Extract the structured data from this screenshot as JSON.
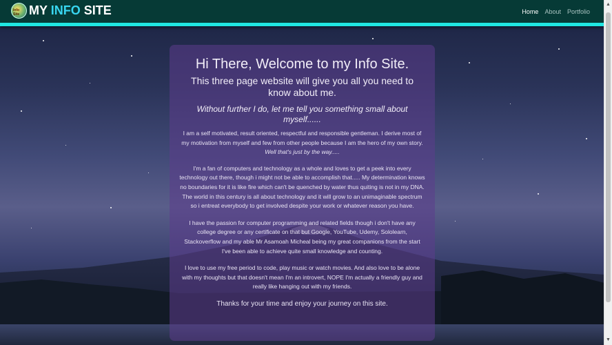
{
  "navbar": {
    "brand_my": "MY",
    "brand_info": "INFO",
    "brand_site": "SITE",
    "logo_text": "Info Site",
    "links": [
      {
        "label": "Home",
        "active": true
      },
      {
        "label": "About",
        "active": false
      },
      {
        "label": "Portfolio",
        "active": false
      }
    ]
  },
  "intro": {
    "heading": "Hi There, Welcome to my Info Site.",
    "subheading": "This three page website will give you all you need to know about me.",
    "tagline": "Without further I do, let me tell you something small about myself......",
    "paragraph1": "I am a self motivated, result oriented, respectful and responsible gentleman. I derive most of my motivation from myself and few from other people because I am the hero of my own story.",
    "paragraph1_aside": "Well that's just by the way.....",
    "paragraph2": "I'm a fan of computers and technology as a whole and loves to get a peek into every technology out there, though i might not be able to accomplish that..... My determination knows no boundaries for it is like fire which can't be quenched by water thus quiting is not in my DNA. The world in this century is all about technology and it will grow to an unimaginable spectrum so i entreat everybody to get involved despite your work or whatever reason you have.",
    "paragraph3": "I have the passion for computer programming and related fields though i don't have any college degree or any certificate on that but Google, YouTube, Udemy, Sololearn, Stackoverflow and my able Mr Asamoah Micheal being my great companions from the start I've been able to achieve quite small knowledge and counting.",
    "paragraph4": "I love to use my free period to code, play music or watch movies. And also love to be alone with my thoughts but that doesn't mean I'm an introvert, NOPE I'm actually a friendly guy and really like hanging out with my friends.",
    "thanks": "Thanks for your time and enjoy your journey on this site."
  },
  "colors": {
    "navbar_bg": "#063a36",
    "navbar_accent": "#20e6e2",
    "brand_info": "#38d6f0",
    "card_bg": "rgba(92, 60, 140, 0.55)"
  },
  "icons": {
    "logo": "site-logo-icon",
    "scroll_up": "scroll-up-arrow-icon",
    "scroll_down": "scroll-down-arrow-icon"
  }
}
